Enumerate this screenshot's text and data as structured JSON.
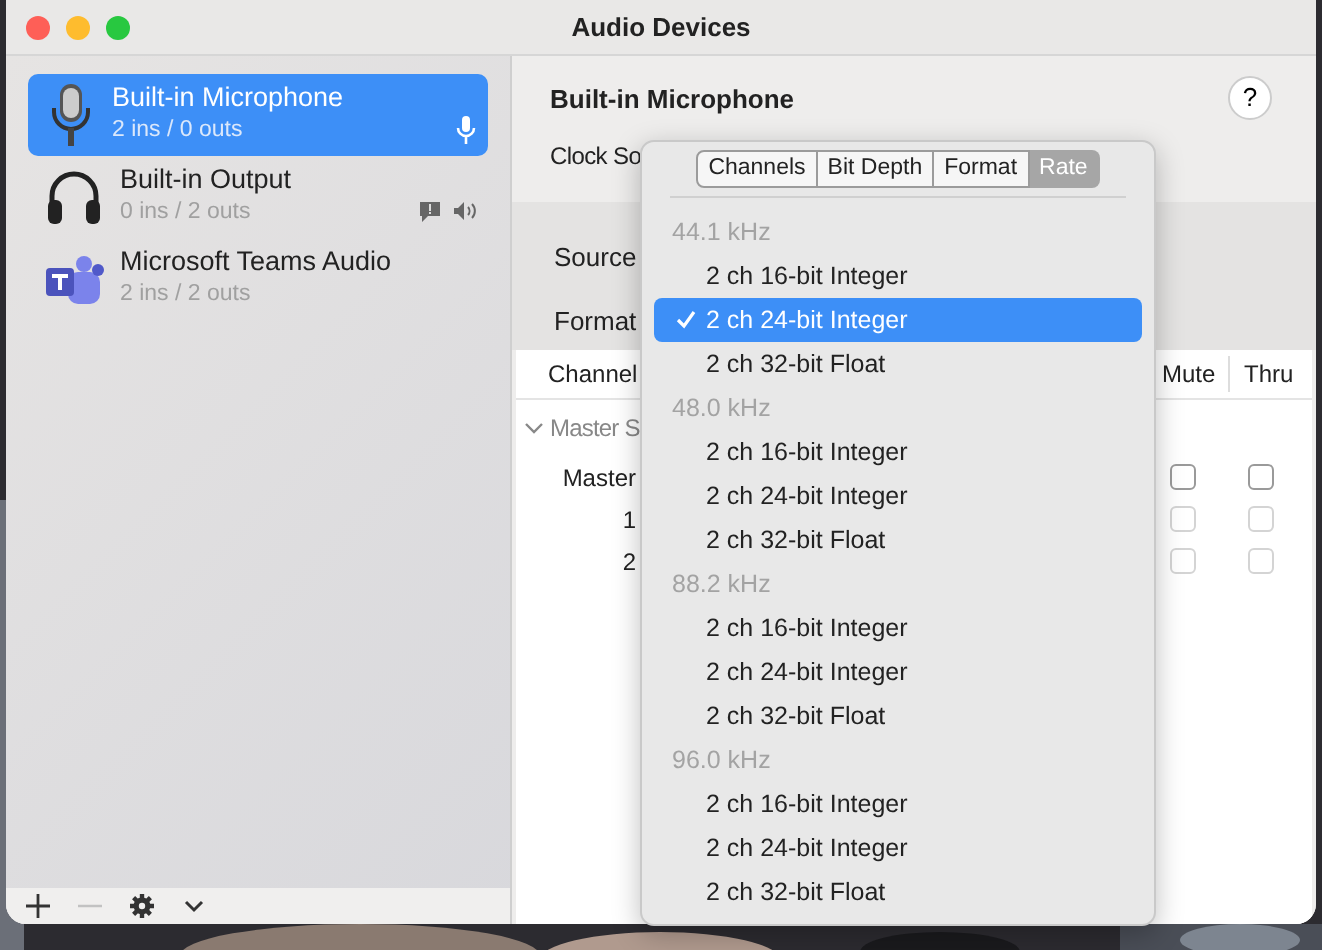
{
  "window": {
    "title": "Audio Devices"
  },
  "devices": [
    {
      "name": "Built-in Microphone",
      "io": "2 ins / 0 outs",
      "kind": "input",
      "selected": true
    },
    {
      "name": "Built-in Output",
      "io": "0 ins / 2 outs",
      "kind": "output",
      "selected": false
    },
    {
      "name": "Microsoft Teams Audio",
      "io": "2 ins / 2 outs",
      "kind": "teams",
      "selected": false
    }
  ],
  "toolbar": [
    {
      "kind": "add",
      "disabled": false
    },
    {
      "kind": "remove",
      "disabled": true
    },
    {
      "kind": "settings",
      "disabled": false
    },
    {
      "kind": "chevron",
      "disabled": false
    }
  ],
  "detail": {
    "title": "Built-in Microphone",
    "help": "?",
    "clock_label": "Clock So",
    "source_label": "Source",
    "format_label": "Format"
  },
  "table": {
    "columns": [
      "Channel",
      "Mute",
      "Thru"
    ],
    "group": {
      "label": "Master S",
      "expanded": true
    },
    "rows": [
      {
        "label": "Master",
        "mute": false,
        "thru": false,
        "disabled": false
      },
      {
        "label": "1",
        "mute": false,
        "thru": false,
        "disabled": true
      },
      {
        "label": "2",
        "mute": false,
        "thru": false,
        "disabled": true
      }
    ]
  },
  "popup": {
    "tabs": [
      {
        "label": "Channels",
        "selected": false
      },
      {
        "label": "Bit Depth",
        "selected": false
      },
      {
        "label": "Format",
        "selected": false
      },
      {
        "label": "Rate",
        "selected": true
      }
    ],
    "groups": [
      {
        "header": "44.1 kHz",
        "items": [
          {
            "label": "2 ch 16-bit Integer",
            "selected": false
          },
          {
            "label": "2 ch 24-bit Integer",
            "selected": true
          },
          {
            "label": "2 ch 32-bit Float",
            "selected": false
          }
        ]
      },
      {
        "header": "48.0 kHz",
        "items": [
          {
            "label": "2 ch 16-bit Integer",
            "selected": false
          },
          {
            "label": "2 ch 24-bit Integer",
            "selected": false
          },
          {
            "label": "2 ch 32-bit Float",
            "selected": false
          }
        ]
      },
      {
        "header": "88.2 kHz",
        "items": [
          {
            "label": "2 ch 16-bit Integer",
            "selected": false
          },
          {
            "label": "2 ch 24-bit Integer",
            "selected": false
          },
          {
            "label": "2 ch 32-bit Float",
            "selected": false
          }
        ]
      },
      {
        "header": "96.0 kHz",
        "items": [
          {
            "label": "2 ch 16-bit Integer",
            "selected": false
          },
          {
            "label": "2 ch 24-bit Integer",
            "selected": false
          },
          {
            "label": "2 ch 32-bit Float",
            "selected": false
          }
        ]
      }
    ]
  }
}
